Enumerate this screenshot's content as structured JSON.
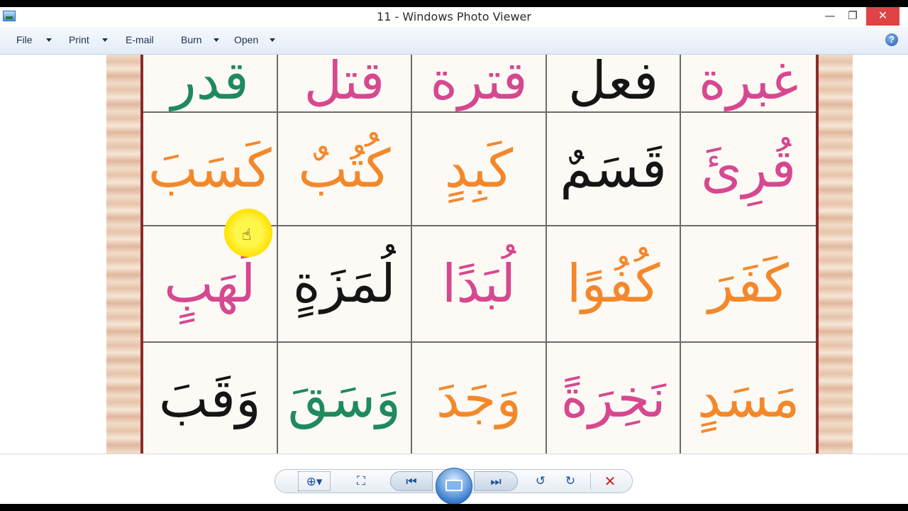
{
  "window": {
    "title": "11 - Windows Photo Viewer",
    "controls": {
      "minimize": "—",
      "maximize": "❐",
      "close": "✕"
    }
  },
  "menu": {
    "file": "File",
    "print": "Print",
    "email": "E-mail",
    "burn": "Burn",
    "open": "Open",
    "help": "?"
  },
  "photo": {
    "rows": [
      [
        {
          "text": "قدر",
          "color": "green"
        },
        {
          "text": "قتل",
          "color": "pink"
        },
        {
          "text": "قترة",
          "color": "pink"
        },
        {
          "text": "فعل",
          "color": "black"
        },
        {
          "text": "غبرة",
          "color": "pink"
        }
      ],
      [
        {
          "text": "كَسَبَ",
          "color": "orange"
        },
        {
          "text": "كُتُبٌ",
          "color": "orange"
        },
        {
          "text": "كَبِدٍ",
          "color": "orange"
        },
        {
          "text": "قَسَمٌ",
          "color": "black"
        },
        {
          "text": "قُرِئَ",
          "color": "pink"
        }
      ],
      [
        {
          "text": "لَهَبٍ",
          "color": "pink"
        },
        {
          "text": "لُمَزَةٍ",
          "color": "black"
        },
        {
          "text": "لُبَدًا",
          "color": "pink"
        },
        {
          "text": "كُفُوًا",
          "color": "orange"
        },
        {
          "text": "كَفَرَ",
          "color": "orange"
        }
      ],
      [
        {
          "text": "وَقَبَ",
          "color": "black"
        },
        {
          "text": "وَسَقَ",
          "color": "green"
        },
        {
          "text": "وَجَدَ",
          "color": "orange"
        },
        {
          "text": "نَخِرَةً",
          "color": "pink"
        },
        {
          "text": "مَسَدٍ",
          "color": "orange"
        }
      ]
    ],
    "colors": {
      "pink": "#d6488f",
      "green": "#1e8a5e",
      "orange": "#f3882b",
      "black": "#151515"
    }
  },
  "toolbar": {
    "zoom_icon": "zoom-icon",
    "fit_icon": "fit-window-icon",
    "prev_icon": "previous-icon",
    "slideshow_icon": "slideshow-icon",
    "next_icon": "next-icon",
    "rotate_left_icon": "rotate-left-icon",
    "rotate_right_icon": "rotate-right-icon",
    "delete_icon": "delete-icon"
  }
}
